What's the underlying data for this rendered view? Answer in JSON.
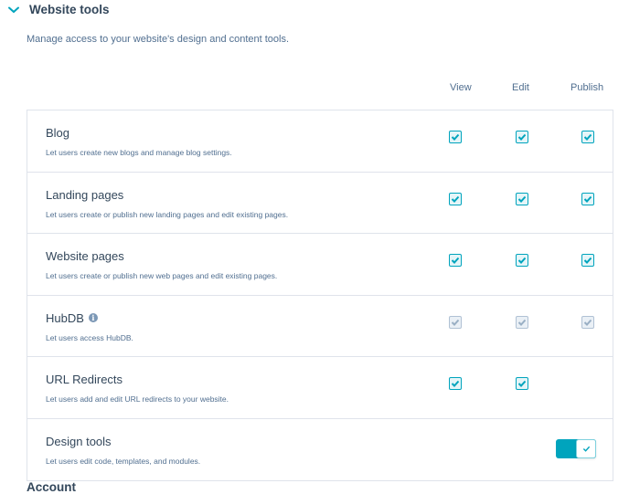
{
  "section": {
    "title": "Website tools",
    "description": "Manage access to your website's design and content tools.",
    "expanded": true
  },
  "columns": [
    "View",
    "Edit",
    "Publish"
  ],
  "rows": [
    {
      "title": "Blog",
      "description": "Let users create new blogs and manage blog settings.",
      "view": true,
      "edit": true,
      "publish": true,
      "disabled": false
    },
    {
      "title": "Landing pages",
      "description": "Let users create or publish new landing pages and edit existing pages.",
      "view": true,
      "edit": true,
      "publish": true,
      "disabled": false
    },
    {
      "title": "Website pages",
      "description": "Let users create or publish new web pages and edit existing pages.",
      "view": true,
      "edit": true,
      "publish": true,
      "disabled": false
    },
    {
      "title": "HubDB",
      "description": "Let users access HubDB.",
      "view": true,
      "edit": true,
      "publish": true,
      "disabled": true,
      "info_icon": "info-icon"
    },
    {
      "title": "URL Redirects",
      "description": "Let users add and edit URL redirects to your website.",
      "view": true,
      "edit": true,
      "disabled": false
    },
    {
      "title": "Design tools",
      "description": "Let users edit code, templates, and modules.",
      "toggle": true
    }
  ],
  "next_section": {
    "title": "Account"
  },
  "colors": {
    "accent": "#00a4bd",
    "text": "#33475b",
    "muted": "#516f90",
    "border": "#dfe3eb"
  }
}
